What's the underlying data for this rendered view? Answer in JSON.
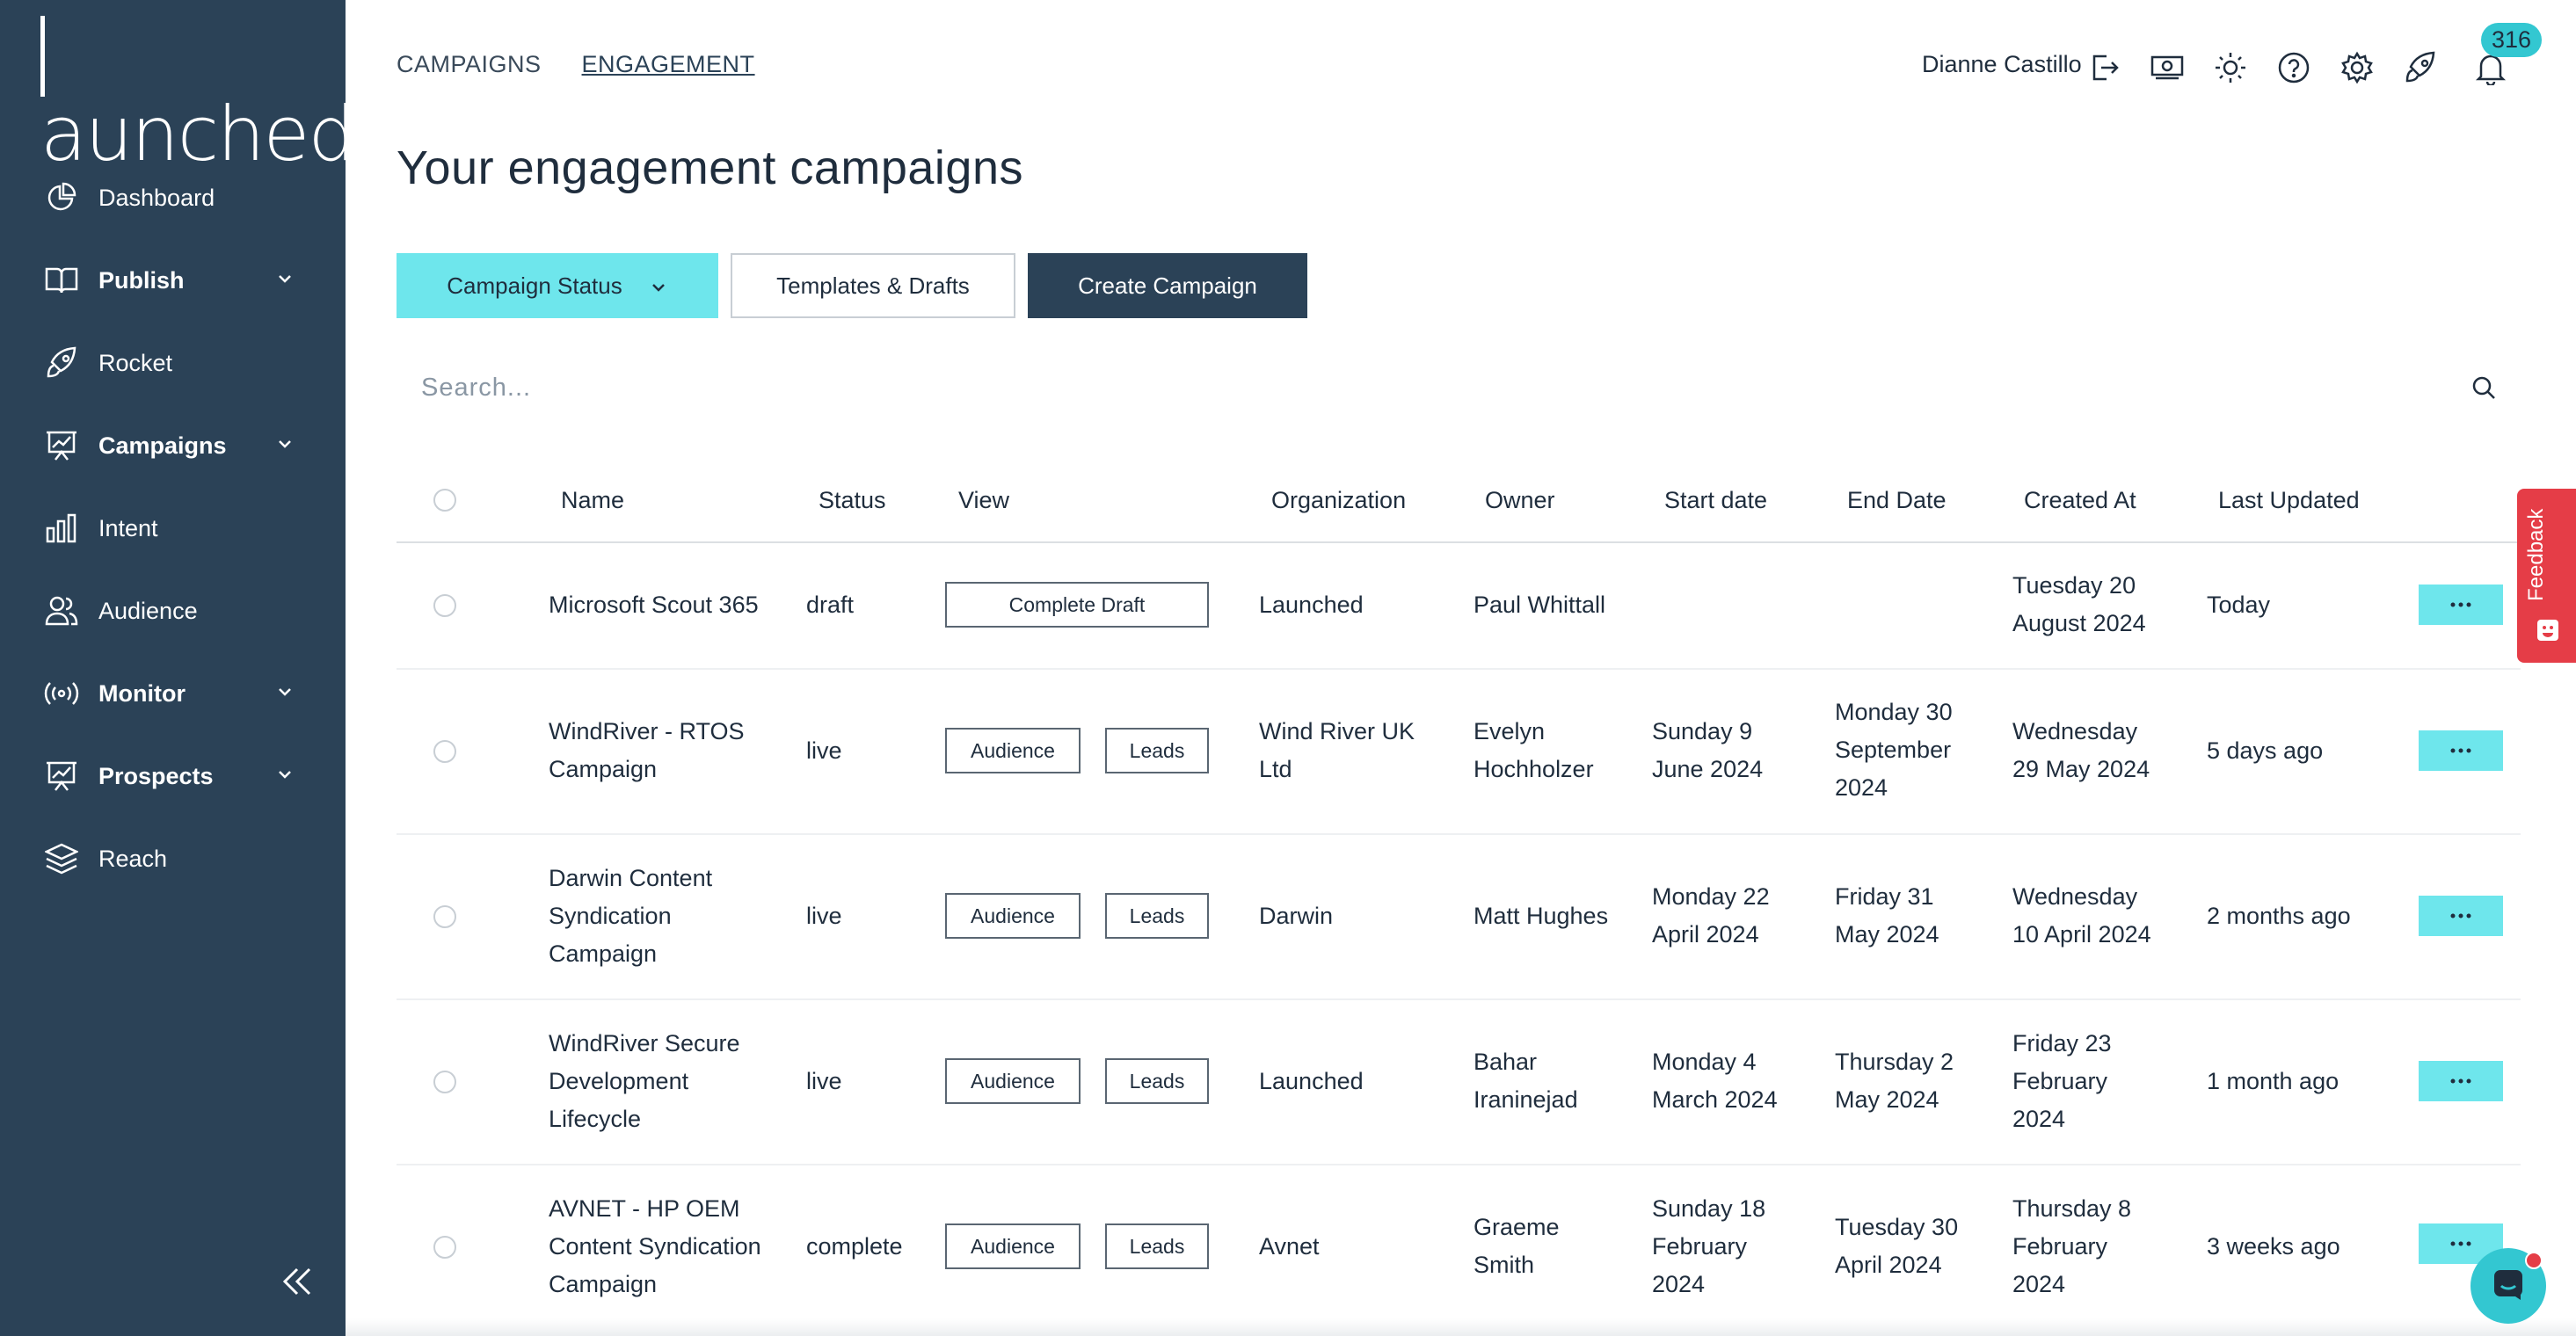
{
  "brand": {
    "logo_text": "aunched"
  },
  "sidebar": {
    "items": [
      {
        "label": "Dashboard",
        "icon": "pie-chart-icon",
        "expandable": false
      },
      {
        "label": "Publish",
        "icon": "book-icon",
        "expandable": true
      },
      {
        "label": "Rocket",
        "icon": "rocket-icon",
        "expandable": false
      },
      {
        "label": "Campaigns",
        "icon": "chart-board-icon",
        "expandable": true
      },
      {
        "label": "Intent",
        "icon": "bar-chart-icon",
        "expandable": false
      },
      {
        "label": "Audience",
        "icon": "users-icon",
        "expandable": false
      },
      {
        "label": "Monitor",
        "icon": "broadcast-icon",
        "expandable": true
      },
      {
        "label": "Prospects",
        "icon": "chart-board-icon",
        "expandable": true
      },
      {
        "label": "Reach",
        "icon": "layers-icon",
        "expandable": false
      }
    ]
  },
  "topnav": {
    "tab_campaigns": "CAMPAIGNS",
    "tab_engagement": "ENGAGEMENT"
  },
  "header": {
    "user_name": "Dianne Castillo",
    "notification_count": "316"
  },
  "page": {
    "title": "Your engagement campaigns",
    "btn_status": "Campaign Status",
    "btn_templates": "Templates & Drafts",
    "btn_create": "Create Campaign",
    "search_placeholder": "Search..."
  },
  "table": {
    "columns": [
      "Name",
      "Status",
      "View",
      "Organization",
      "Owner",
      "Start date",
      "End Date",
      "Created At",
      "Last Updated"
    ],
    "rows": [
      {
        "name": [
          "Microsoft Scout 365"
        ],
        "status": "draft",
        "view_buttons": [
          "Complete Draft"
        ],
        "organization": [
          "Launched"
        ],
        "owner": [
          "Paul Whittall"
        ],
        "start": [],
        "end": [],
        "created": [
          "Tuesday 20",
          "August 2024"
        ],
        "updated": "Today"
      },
      {
        "name": [
          "WindRiver - RTOS",
          "Campaign"
        ],
        "status": "live",
        "view_buttons": [
          "Audience",
          "Leads"
        ],
        "organization": [
          "Wind River UK",
          "Ltd"
        ],
        "owner": [
          "Evelyn",
          "Hochholzer"
        ],
        "start": [
          "Sunday 9",
          "June 2024"
        ],
        "end": [
          "Monday 30",
          "September",
          "2024"
        ],
        "created": [
          "Wednesday",
          "29 May 2024"
        ],
        "updated": "5 days ago"
      },
      {
        "name": [
          "Darwin Content",
          "Syndication",
          "Campaign"
        ],
        "status": "live",
        "view_buttons": [
          "Audience",
          "Leads"
        ],
        "organization": [
          "Darwin"
        ],
        "owner": [
          "Matt Hughes"
        ],
        "start": [
          "Monday 22",
          "April 2024"
        ],
        "end": [
          "Friday 31",
          "May 2024"
        ],
        "created": [
          "Wednesday",
          "10 April 2024"
        ],
        "updated": "2 months ago"
      },
      {
        "name": [
          "WindRiver Secure",
          "Development",
          "Lifecycle"
        ],
        "status": "live",
        "view_buttons": [
          "Audience",
          "Leads"
        ],
        "organization": [
          "Launched"
        ],
        "owner": [
          "Bahar",
          "Iraninejad"
        ],
        "start": [
          "Monday 4",
          "March 2024"
        ],
        "end": [
          "Thursday 2",
          "May 2024"
        ],
        "created": [
          "Friday 23",
          "February",
          "2024"
        ],
        "updated": "1 month ago"
      },
      {
        "name": [
          "AVNET - HP OEM",
          "Content Syndication",
          "Campaign"
        ],
        "status": "complete",
        "view_buttons": [
          "Audience",
          "Leads"
        ],
        "organization": [
          "Avnet"
        ],
        "owner": [
          "Graeme",
          "Smith"
        ],
        "start": [
          "Sunday 18",
          "February",
          "2024"
        ],
        "end": [
          "Tuesday 30",
          "April 2024"
        ],
        "created": [
          "Thursday 8",
          "February",
          "2024"
        ],
        "updated": "3 weeks ago"
      }
    ]
  },
  "feedback": {
    "label": "Feedback"
  },
  "colors": {
    "sidebar": "#2b4257",
    "accent": "#6ee6ec",
    "badge": "#33c7d1",
    "feedback": "#e53d47"
  }
}
